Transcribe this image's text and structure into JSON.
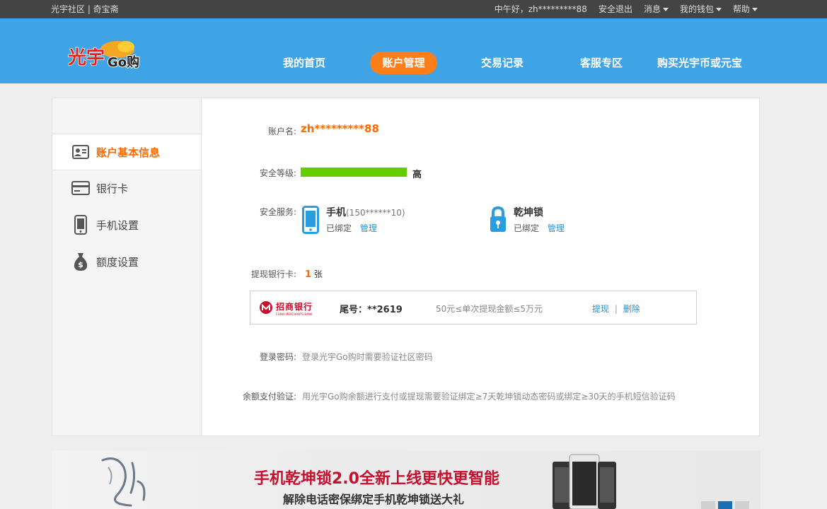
{
  "topbar": {
    "left": "光宇社区 | 奇宝斋",
    "greeting": "中午好，zh*********88",
    "logout": "安全退出",
    "messages": "消息",
    "wallet": "我的钱包",
    "help": "帮助"
  },
  "header": {
    "logo_text": "光宇",
    "logo_go": "Go购",
    "nav": [
      "我的首页",
      "账户管理",
      "交易记录",
      "客服专区",
      "购买光宇币或元宝"
    ]
  },
  "sidebar": {
    "items": [
      "账户基本信息",
      "银行卡",
      "手机设置",
      "额度设置"
    ]
  },
  "account": {
    "name_label": "账户名:",
    "name_value": "zh*********88",
    "security_label": "安全等级:",
    "security_level_text": "高",
    "security_level_fraction": 1.0,
    "service_label": "安全服务:",
    "phone_title": "手机",
    "phone_number": "(150******10)",
    "phone_status": "已绑定",
    "phone_manage": "管理",
    "lock_title": "乾坤锁",
    "lock_status": "已绑定",
    "lock_manage": "管理",
    "bank_label": "提现银行卡:",
    "bank_count": "1",
    "bank_unit": "张",
    "bank_name": "招商银行",
    "bank_name_en": "CHINA MERCHANTS BANK",
    "bank_tail_label": "尾号：",
    "bank_tail": "**2619",
    "bank_limit": "50元≤单次提现金额≤5万元",
    "bank_withdraw": "提现",
    "bank_delete": "删除",
    "login_pw_label": "登录密码:",
    "login_pw_text": "登录光宇Go购时需要验证社区密码",
    "balance_label": "余额支付验证:",
    "balance_text": "用光宇Go购余额进行支付或提现需要验证绑定≥7天乾坤锁动态密码或绑定≥30天的手机短信验证码"
  },
  "banner": {
    "title": "手机乾坤锁2.0全新上线更快更智能",
    "subtitle": "解除电话密保绑定手机乾坤锁送大礼"
  },
  "colors": {
    "accent": "#ff7e1a",
    "header_blue": "#3ea4e6",
    "link_blue": "#2a8fd6",
    "security_green": "#66cc00",
    "banner_red": "#c8102e"
  }
}
